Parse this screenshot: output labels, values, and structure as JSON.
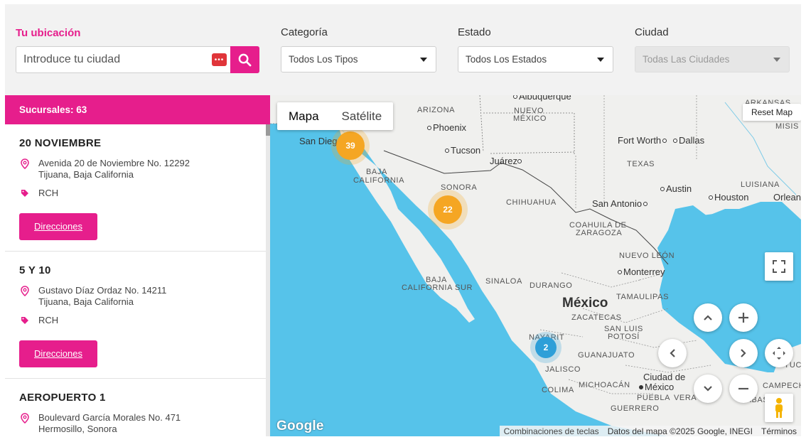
{
  "filters": {
    "location_label": "Tu ubicación",
    "location_placeholder": "Introduce tu ciudad",
    "category_label": "Categoría",
    "category_value": "Todos Los Tipos",
    "state_label": "Estado",
    "state_value": "Todos Los Estados",
    "city_label": "Ciudad",
    "city_value": "Todas Las Ciudades"
  },
  "list": {
    "count_label": "Sucursales: 63",
    "stores": [
      {
        "name": "20 NOVIEMBRE",
        "address_line1": "Avenida 20 de Noviembre No. 12292",
        "address_line2": "Tijuana, Baja California",
        "tag": "RCH",
        "button": "Direcciones"
      },
      {
        "name": "5 Y 10",
        "address_line1": "Gustavo Díaz Ordaz No. 14211",
        "address_line2": "Tijuana, Baja California",
        "tag": "RCH",
        "button": "Direcciones"
      },
      {
        "name": "AEROPUERTO 1",
        "address_line1": "Boulevard García Morales No. 471",
        "address_line2": "Hermosillo, Sonora"
      }
    ]
  },
  "map": {
    "type_map": "Mapa",
    "type_satellite": "Satélite",
    "reset": "Reset Map",
    "clusters": [
      {
        "count": "39",
        "color": "#f5a623"
      },
      {
        "count": "22",
        "color": "#f5a623"
      },
      {
        "count": "2",
        "color": "#2e9fd8"
      }
    ],
    "labels": {
      "albuquerque": "Albuquerque",
      "arizona": "ARIZONA",
      "nuevo_mexico_1": "NUEVO",
      "nuevo_mexico_2": "MÉXICO",
      "phoenix": "Phoenix",
      "tucson": "Tucson",
      "san_diego": "San Dieg",
      "juarez": "Juárez",
      "baja_california_1": "BAJA",
      "baja_california_2": "CALIFORNIA",
      "sonora": "SONORA",
      "chihuahua": "CHIHUAHUA",
      "fort_worth": "Fort Worth",
      "dallas": "Dallas",
      "texas": "TEXAS",
      "austin": "Austin",
      "houston": "Houston",
      "san_antonio": "San Antonio",
      "luisiana": "LUISIANA",
      "orleans": "Orleans",
      "arkansas": "ARKANSAS",
      "misis": "MISIS",
      "coahuila_1": "COAHUILA DE",
      "coahuila_2": "ZARAGOZA",
      "nuevo_leon": "NUEVO LEÓN",
      "monterrey": "Monterrey",
      "bcs_1": "BAJA",
      "bcs_2": "CALIFORNIA SUR",
      "sinaloa": "SINALOA",
      "durango": "DURANGO",
      "mexico": "México",
      "tamaulipas": "TAMAULIPAS",
      "zacatecas": "ZACATECAS",
      "san_luis_1": "SAN LUIS",
      "san_luis_2": "POTOSÍ",
      "nayarit": "NAYARIT",
      "guanajuato": "GUANAJUATO",
      "jalisco": "JALISCO",
      "cdmx_1": "Ciudad de",
      "cdmx_2": "México",
      "colima": "COLIMA",
      "michoacan": "MICHOACÁN",
      "puebla": "PUEBLA",
      "veracruz": "VERA",
      "guerrero": "GUERRERO",
      "tabasco": "TABASCO",
      "campeche": "CAMPECHE",
      "yuc": "YUC"
    },
    "google": "Google",
    "attribution_keys": "Combinaciones de teclas",
    "attribution_data": "Datos del mapa ©2025 Google, INEGI",
    "attribution_terms": "Términos"
  },
  "colors": {
    "brand": "#e61e8c",
    "water": "#56c3ea",
    "land": "#f0f0ee"
  },
  "icons": {
    "search": "search-icon",
    "pin": "map-pin-icon",
    "tag": "tag-icon",
    "fullscreen": "fullscreen-icon",
    "pegman": "pegman-icon"
  }
}
